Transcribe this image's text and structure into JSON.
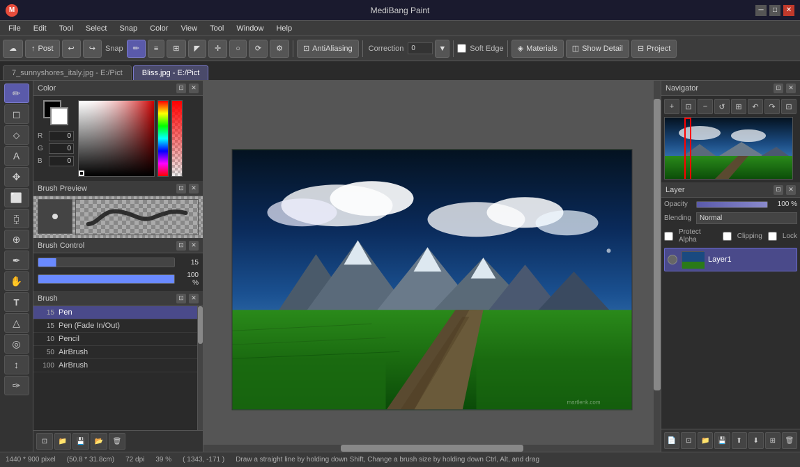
{
  "app": {
    "title": "MediBang Paint",
    "logo": "M"
  },
  "title_bar": {
    "title": "MediBang Paint",
    "minimize": "─",
    "maximize": "□",
    "close": "✕"
  },
  "menu": {
    "items": [
      "File",
      "Edit",
      "Tool",
      "Select",
      "Snap",
      "Color",
      "View",
      "Tool",
      "Window",
      "Help"
    ]
  },
  "toolbar": {
    "post_label": "Post",
    "snap_label": "Snap",
    "antialiasing_label": "AntiAliasing",
    "correction_label": "Correction",
    "correction_value": "0",
    "soft_edge_label": "Soft Edge",
    "materials_label": "Materials",
    "show_detail_label": "Show Detail",
    "project_label": "Project"
  },
  "tabs": [
    {
      "label": "7_sunnyshores_italy.jpg - E:/Pict",
      "active": false
    },
    {
      "label": "Bliss.jpg - E:/Pict",
      "active": true
    }
  ],
  "color_panel": {
    "title": "Color",
    "r_value": "0",
    "g_value": "0",
    "b_value": "0"
  },
  "brush_preview": {
    "title": "Brush Preview"
  },
  "brush_control": {
    "title": "Brush Control",
    "size_value": "15",
    "opacity_value": "100 %"
  },
  "brush_list": {
    "title": "Brush",
    "items": [
      {
        "size": "15",
        "name": "Pen",
        "active": true
      },
      {
        "size": "15",
        "name": "Pen (Fade In/Out)",
        "active": false
      },
      {
        "size": "10",
        "name": "Pencil",
        "active": false
      },
      {
        "size": "50",
        "name": "AirBrush",
        "active": false
      },
      {
        "size": "100",
        "name": "AirBrush",
        "active": false
      }
    ]
  },
  "navigator": {
    "title": "Navigator"
  },
  "layer_panel": {
    "title": "Layer",
    "opacity_label": "Opacity",
    "opacity_value": "100 %",
    "blending_label": "Blending",
    "blending_value": "Normal",
    "protect_alpha_label": "Protect Alpha",
    "clipping_label": "Clipping",
    "lock_label": "Lock",
    "layer1_name": "Layer1"
  },
  "status_bar": {
    "dimensions": "1440 * 900 pixel",
    "size_cm": "(50.8 * 31.8cm)",
    "dpi": "72 dpi",
    "zoom": "39 %",
    "coords": "( 1343, -171 )",
    "hint": "Draw a straight line by holding down Shift, Change a brush size by holding down Ctrl, Alt, and drag"
  }
}
